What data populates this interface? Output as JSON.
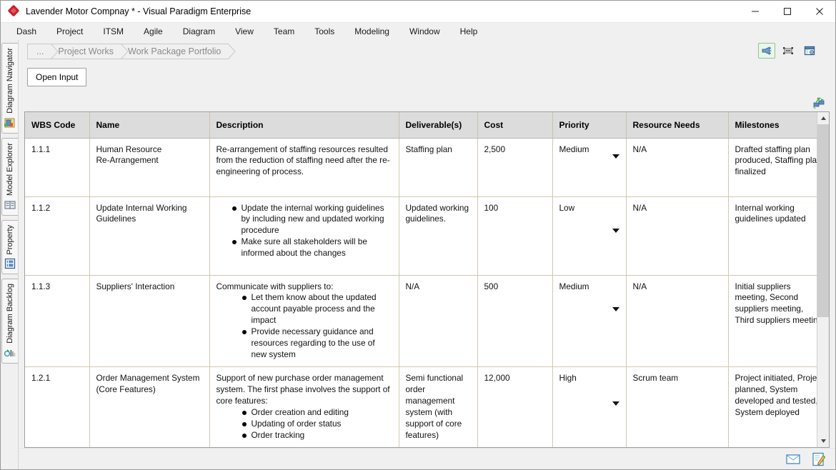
{
  "window": {
    "title": "Lavender Motor Compnay * - Visual Paradigm Enterprise",
    "logo_icon": "visual-paradigm-diamond-icon",
    "minimize_label": "Minimize",
    "maximize_label": "Maximize",
    "close_label": "Close"
  },
  "menubar": {
    "items": [
      {
        "label": "Dash"
      },
      {
        "label": "Project"
      },
      {
        "label": "ITSM"
      },
      {
        "label": "Agile"
      },
      {
        "label": "Diagram"
      },
      {
        "label": "View"
      },
      {
        "label": "Team"
      },
      {
        "label": "Tools"
      },
      {
        "label": "Modeling"
      },
      {
        "label": "Window"
      },
      {
        "label": "Help"
      }
    ]
  },
  "sidebar": {
    "items": [
      {
        "label": "Diagram Navigator",
        "icon": "diagram-navigator-icon"
      },
      {
        "label": "Model Explorer",
        "icon": "model-explorer-icon"
      },
      {
        "label": "Property",
        "icon": "property-icon"
      },
      {
        "label": "Diagram Backlog",
        "icon": "diagram-backlog-icon"
      }
    ]
  },
  "breadcrumb": {
    "items": [
      {
        "label": "..."
      },
      {
        "label": "Project Works"
      },
      {
        "label": "Work Package Portfolio"
      }
    ]
  },
  "toolbar": {
    "icons": [
      {
        "name": "announcement-icon",
        "selected": true
      },
      {
        "name": "fit-to-frame-icon",
        "selected": false
      },
      {
        "name": "panel-layout-icon",
        "selected": false
      }
    ],
    "open_input_label": "Open Input",
    "refresh_icon": "sync-refresh-icon"
  },
  "table": {
    "columns": [
      "WBS Code",
      "Name",
      "Description",
      "Deliverable(s)",
      "Cost",
      "Priority",
      "Resource Needs",
      "Milestones"
    ],
    "rows": [
      {
        "wbs": "1.1.1",
        "name": [
          "Human Resource",
          "Re-Arrangement"
        ],
        "description_intro": "Re-arrangement of staffing resources resulted from the reduction of staffing need after the re-engineering of process.",
        "description_bullets": [],
        "deliverables": [
          "Staffing plan"
        ],
        "cost": "2,500",
        "priority": "Medium",
        "resource_needs": "N/A",
        "milestones": "Drafted staffing plan produced, Staffing plan finalized",
        "more_label": "…"
      },
      {
        "wbs": "1.1.2",
        "name": [
          "Update Internal Working",
          "Guidelines"
        ],
        "description_intro": "",
        "description_bullets": [
          "Update the internal working guidelines by including new and updated working procedure",
          "Make sure all stakeholders will be informed about the changes"
        ],
        "deliverables": [
          "Updated working",
          "guidelines."
        ],
        "cost": "100",
        "priority": "Low",
        "resource_needs": "N/A",
        "milestones": "Internal working guidelines updated",
        "more_label": "…"
      },
      {
        "wbs": "1.1.3",
        "name": [
          "Suppliers' Interaction"
        ],
        "description_intro": "Communicate with suppliers to:",
        "description_bullets": [
          "Let them know about the updated account payable process and the impact",
          "Provide necessary guidance and resources regarding to the use of new system"
        ],
        "deliverables": [
          "N/A"
        ],
        "cost": "500",
        "priority": "Medium",
        "resource_needs": "N/A",
        "milestones": "Initial suppliers meeting, Second suppliers meeting, Third suppliers meeting",
        "more_label": "…"
      },
      {
        "wbs": "1.2.1",
        "name": [
          "Order Management System",
          "(Core Features)"
        ],
        "description_intro": "Support of new purchase order management system. The first phase involves the support of core features:",
        "description_bullets": [
          "Order creation and editing",
          "Updating of order status",
          "Order tracking"
        ],
        "deliverables": [
          "Semi functional",
          "order management",
          "system (with",
          "support of core",
          "features)"
        ],
        "cost": "12,000",
        "priority": "High",
        "resource_needs": "Scrum team",
        "milestones": "Project initiated, Project planned, System developed and tested, System deployed",
        "more_label": "…"
      }
    ]
  },
  "scrollbar": {
    "up_label": "Scroll up",
    "down_label": "Scroll down"
  },
  "statusbar": {
    "icons": [
      {
        "name": "message-envelope-icon"
      },
      {
        "name": "edit-note-icon"
      }
    ]
  },
  "colors": {
    "header_bg": "#dcdcdc",
    "grid_line": "#cfc9b0",
    "crumb_text": "#8a8a8a",
    "accent_red": "#c8202a",
    "selected_border": "#8ec78e"
  }
}
